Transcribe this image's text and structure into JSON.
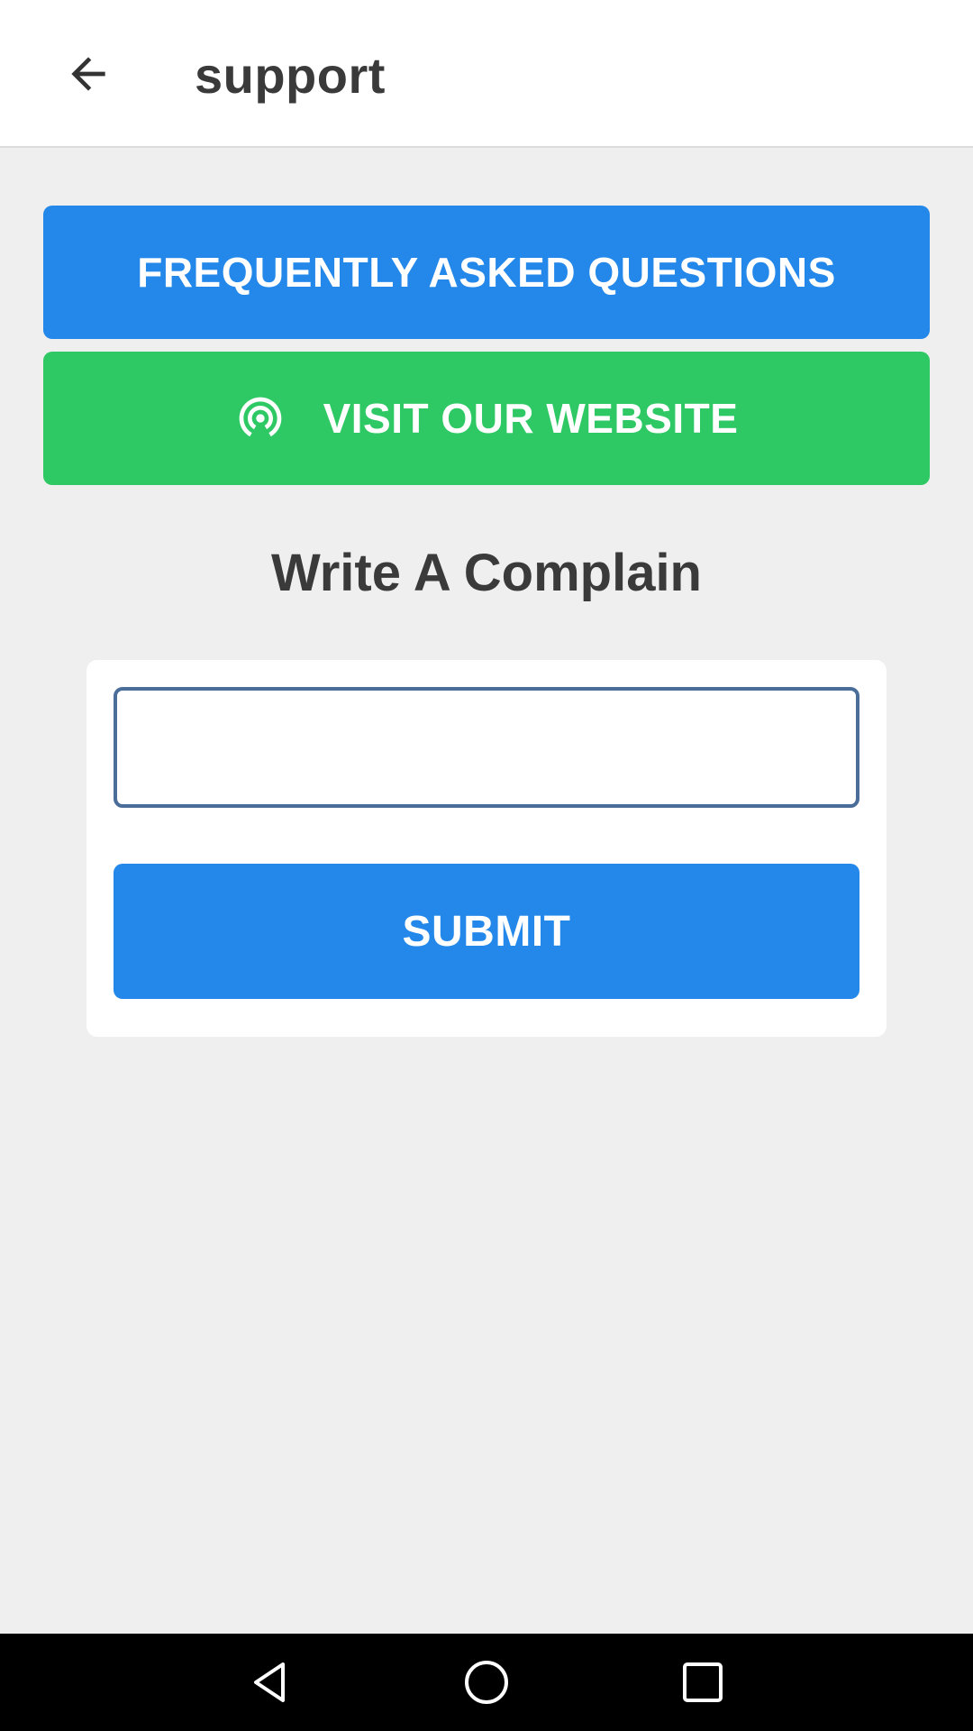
{
  "appbar": {
    "title": "support",
    "back_icon": "arrow-left-icon"
  },
  "buttons": {
    "faq_label": "FREQUENTLY ASKED QUESTIONS",
    "website_label": "VISIT OUR WEBSITE",
    "website_icon": "broadcast-icon"
  },
  "complain": {
    "title": "Write A Complain",
    "input_value": "",
    "input_placeholder": "",
    "submit_label": "SUBMIT"
  },
  "colors": {
    "primary_blue": "#2388ea",
    "accent_green": "#2ec965",
    "input_border": "#4a6d9a",
    "background": "#efefef"
  },
  "navbar": {
    "back_icon": "triangle-back-icon",
    "home_icon": "circle-home-icon",
    "recent_icon": "square-recents-icon"
  }
}
